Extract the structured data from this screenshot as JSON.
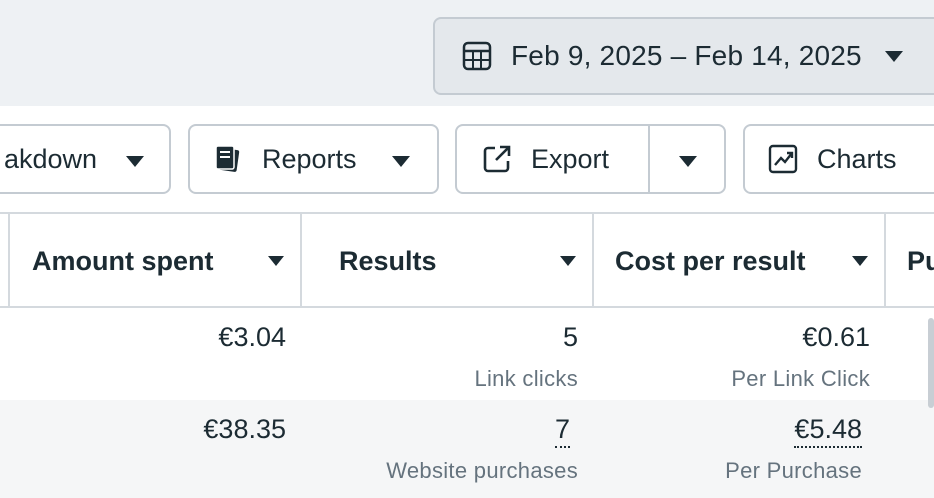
{
  "date_range": {
    "label": "Feb 9, 2025 – Feb 14, 2025"
  },
  "toolbar": {
    "breakdown_label": "akdown",
    "reports_label": "Reports",
    "export_label": "Export",
    "charts_label": "Charts"
  },
  "table": {
    "columns": [
      {
        "label": "Amount spent"
      },
      {
        "label": "Results"
      },
      {
        "label": "Cost per result"
      },
      {
        "label": "Pu"
      }
    ],
    "rows": [
      {
        "amount_spent": "€3.04",
        "results": "5",
        "results_type": "Link clicks",
        "cost_per_result": "€0.61",
        "cost_type": "Per Link Click"
      },
      {
        "amount_spent": "€38.35",
        "results": "7",
        "results_type": "Website purchases",
        "cost_per_result": "€5.48",
        "cost_type": "Per Purchase"
      }
    ]
  },
  "colors": {
    "text": "#1c2b33",
    "muted": "#65737e",
    "border": "#c4cbd2",
    "topbar_bg": "#eef1f4"
  }
}
